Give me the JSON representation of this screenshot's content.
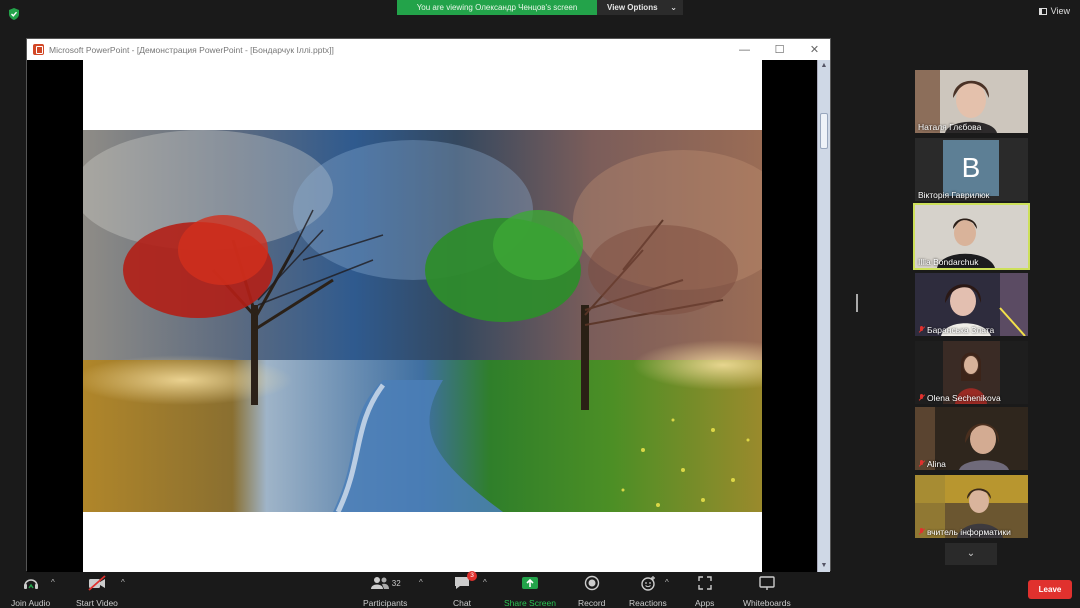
{
  "banner": {
    "viewing_text": "You are viewing Олександр Ченцов's screen",
    "options_label": "View Options",
    "options_caret": "⌄"
  },
  "top_right": {
    "view_label": "View"
  },
  "shared_window": {
    "title": "Microsoft PowerPoint - [Демонстрация PowerPoint - [Бондарчук Іллі.pptx]]",
    "minimize": "—",
    "maximize": "☐",
    "close": "✕",
    "scroll_up": "▲",
    "scroll_down": "▼"
  },
  "participants_panel": {
    "tiles": [
      {
        "name": "Наталя Глєбова",
        "muted": false
      },
      {
        "name": "Вікторія Гаврилюк",
        "muted": false,
        "avatar_letter": "B"
      },
      {
        "name": "Illia Bondarchuk",
        "muted": false,
        "active_speaker": true
      },
      {
        "name": "Баранська Злата",
        "muted": true
      },
      {
        "name": "Olena Sechenikova",
        "muted": true
      },
      {
        "name": "Alina",
        "muted": true
      },
      {
        "name": "вчитель інформатики",
        "muted": true
      }
    ],
    "scroll_down_icon": "⌄"
  },
  "toolbar": {
    "join_audio": "Join Audio",
    "start_video": "Start Video",
    "participants": "Participants",
    "participants_count": "32",
    "chat": "Chat",
    "chat_badge": "3",
    "share_screen": "Share Screen",
    "record": "Record",
    "reactions": "Reactions",
    "apps": "Apps",
    "whiteboards": "Whiteboards",
    "caret": "^",
    "leave": "Leave"
  },
  "colors": {
    "zoom_green": "#23a34a",
    "leave_red": "#e0312e",
    "active_speaker_border": "#cde05a"
  }
}
